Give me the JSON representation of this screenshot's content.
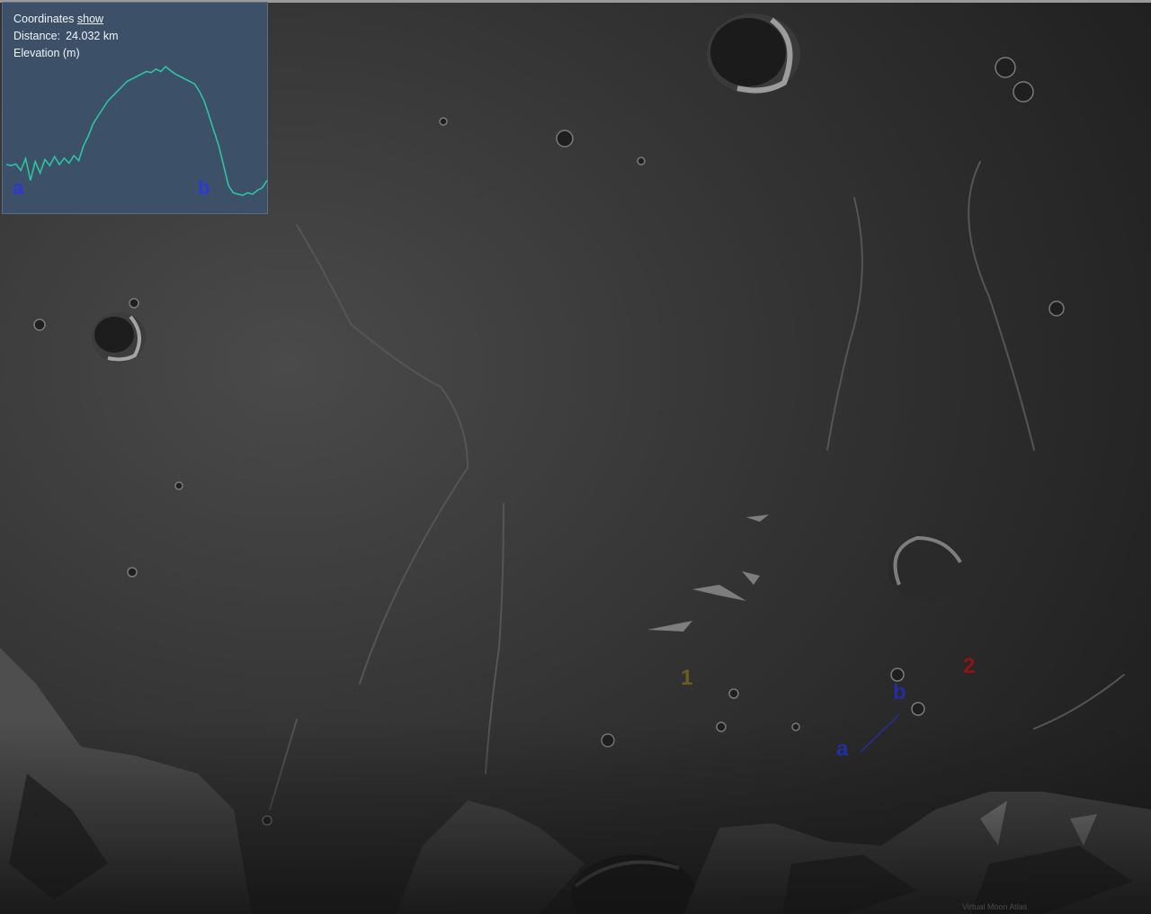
{
  "panel": {
    "coordinates_label": "Coordinates",
    "coordinates_link": "show",
    "distance_label": "Distance:",
    "distance_value": "24.032 km",
    "elevation_label": "Elevation (m)",
    "profile_point_a": "a",
    "profile_point_b": "b",
    "profile_color": "#2ec4a0"
  },
  "map": {
    "label_1": "1",
    "label_2": "2",
    "point_a": "a",
    "point_b": "b",
    "label_1_color": "#6e5e1e",
    "label_2_color": "#8c1616",
    "point_color": "#2030a0",
    "watermark": "Virtual Moon Atlas"
  },
  "profile_data": {
    "description_units": "relative elevation along profile a to b",
    "values": [
      0.62,
      0.6,
      0.63,
      0.5,
      0.74,
      0.3,
      0.68,
      0.45,
      0.72,
      0.6,
      0.78,
      0.62,
      0.75,
      0.65,
      0.8,
      0.7,
      1.0,
      1.2,
      1.45,
      1.6,
      1.75,
      1.9,
      2.0,
      2.1,
      2.2,
      2.3,
      2.35,
      2.4,
      2.45,
      2.5,
      2.48,
      2.55,
      2.5,
      2.6,
      2.52,
      2.45,
      2.4,
      2.35,
      2.3,
      2.25,
      2.1,
      1.9,
      1.6,
      1.3,
      1.0,
      0.6,
      0.2,
      0.05,
      0.02,
      0.0,
      0.05,
      0.02,
      0.1,
      0.15,
      0.3
    ]
  }
}
